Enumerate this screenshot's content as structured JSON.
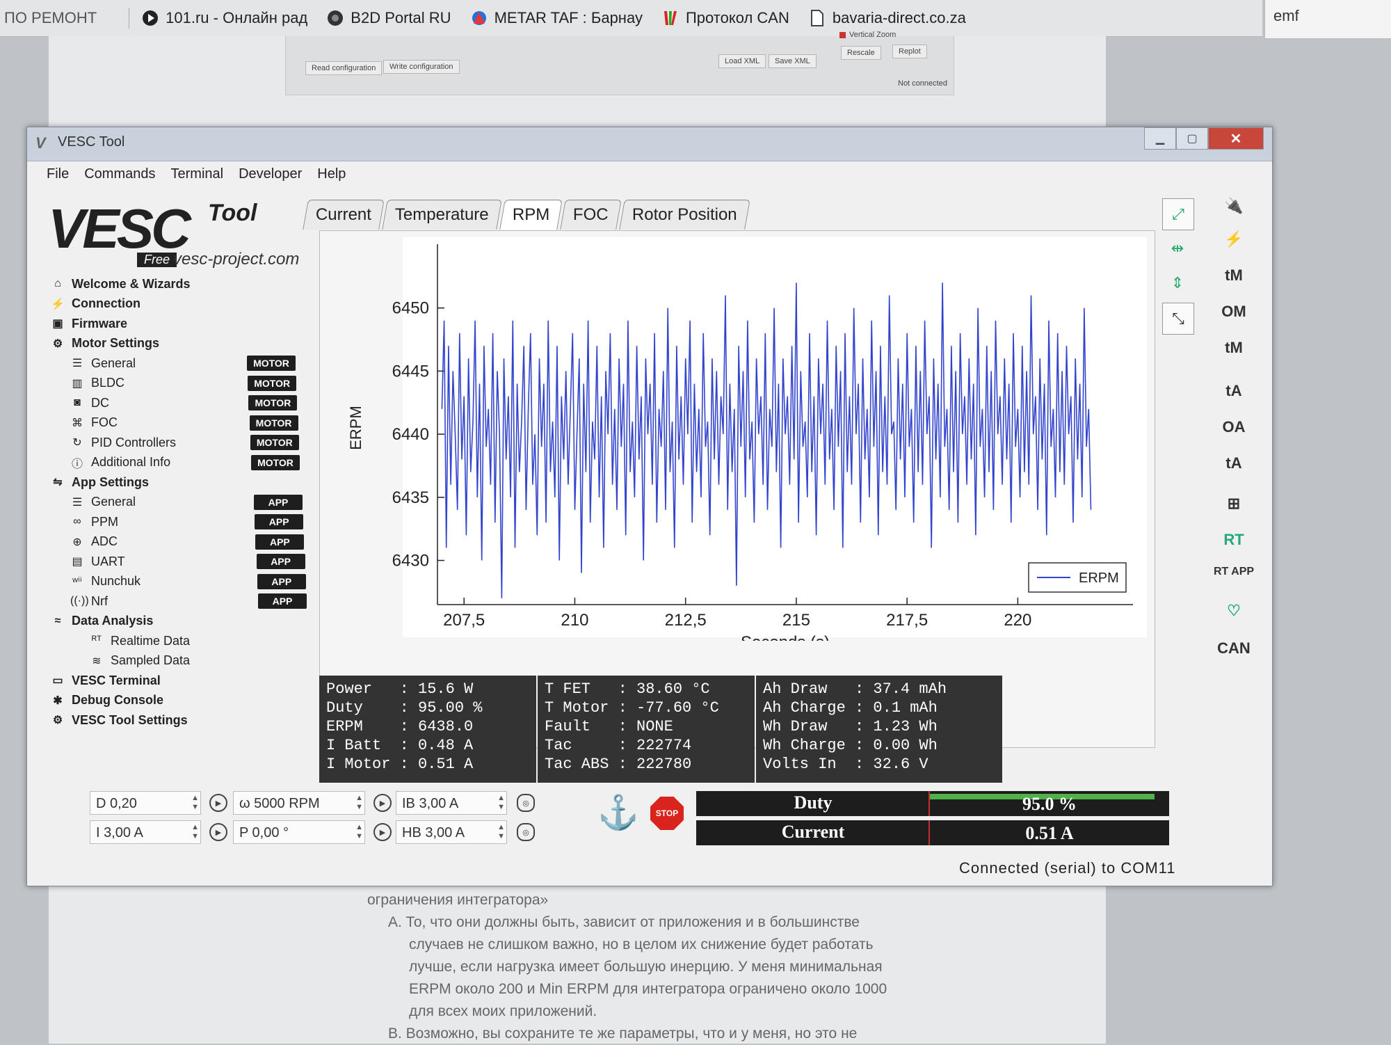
{
  "bookmarks": [
    {
      "label": "ПО РЕМОНТ"
    },
    {
      "label": "101.ru - Онлайн рад"
    },
    {
      "label": "B2D Portal RU"
    },
    {
      "label": "METAR TAF : Барнау"
    },
    {
      "label": "Протокол CAN"
    },
    {
      "label": "bavaria-direct.co.za"
    }
  ],
  "tab_emf": "emf",
  "ghost": {
    "read": "Read configuration",
    "write": "Write configuration",
    "load": "Load XML",
    "save": "Save XML",
    "vzoom": "Vertical Zoom",
    "rescale": "Rescale",
    "replot": "Replot",
    "status": "Not connected"
  },
  "window": {
    "title": "VESC Tool"
  },
  "menu": [
    "File",
    "Commands",
    "Terminal",
    "Developer",
    "Help"
  ],
  "logo": {
    "brand": "VESC",
    "tool": "Tool",
    "edition": "Free",
    "url": "vesc-project.com"
  },
  "sidebar": [
    {
      "label": "Welcome & Wizards",
      "icon": "home-icon",
      "level": 0
    },
    {
      "label": "Connection",
      "icon": "plug-icon",
      "level": 0
    },
    {
      "label": "Firmware",
      "icon": "chip-icon",
      "level": 0
    },
    {
      "label": "Motor Settings",
      "icon": "motor-icon",
      "level": 0
    },
    {
      "label": "General",
      "icon": "sliders-icon",
      "level": 1,
      "badge": "MOTOR"
    },
    {
      "label": "BLDC",
      "icon": "bldc-icon",
      "level": 1,
      "badge": "MOTOR"
    },
    {
      "label": "DC",
      "icon": "dc-icon",
      "level": 1,
      "badge": "MOTOR"
    },
    {
      "label": "FOC",
      "icon": "foc-icon",
      "level": 1,
      "badge": "MOTOR"
    },
    {
      "label": "PID Controllers",
      "icon": "pid-icon",
      "level": 1,
      "badge": "MOTOR"
    },
    {
      "label": "Additional Info",
      "icon": "info-icon",
      "level": 1,
      "badge": "MOTOR"
    },
    {
      "label": "App Settings",
      "icon": "app-icon",
      "level": 0
    },
    {
      "label": "General",
      "icon": "sliders-icon",
      "level": 1,
      "badge": "APP"
    },
    {
      "label": "PPM",
      "icon": "ppm-icon",
      "level": 1,
      "badge": "APP"
    },
    {
      "label": "ADC",
      "icon": "adc-icon",
      "level": 1,
      "badge": "APP"
    },
    {
      "label": "UART",
      "icon": "uart-icon",
      "level": 1,
      "badge": "APP"
    },
    {
      "label": "Nunchuk",
      "icon": "wii-icon",
      "level": 1,
      "badge": "APP"
    },
    {
      "label": "Nrf",
      "icon": "wireless-icon",
      "level": 1,
      "badge": "APP"
    },
    {
      "label": "Data Analysis",
      "icon": "analysis-icon",
      "level": 0
    },
    {
      "label": "Realtime Data",
      "icon": "rt-icon",
      "level": 2
    },
    {
      "label": "Sampled Data",
      "icon": "sampled-icon",
      "level": 2
    },
    {
      "label": "VESC Terminal",
      "icon": "terminal-icon",
      "level": 0
    },
    {
      "label": "Debug Console",
      "icon": "bug-icon",
      "level": 0
    },
    {
      "label": "VESC Tool Settings",
      "icon": "gear-icon",
      "level": 0
    }
  ],
  "tabs": [
    {
      "label": "Current"
    },
    {
      "label": "Temperature"
    },
    {
      "label": "RPM",
      "active": true
    },
    {
      "label": "FOC"
    },
    {
      "label": "Rotor Position"
    }
  ],
  "chart_data": {
    "type": "line",
    "xlabel": "Seconds (s)",
    "ylabel": "ERPM",
    "xlim": [
      206.9,
      222.6
    ],
    "ylim": [
      6426.5,
      6454.5
    ],
    "xticks": [
      207.5,
      210,
      212.5,
      215,
      217.5,
      220
    ],
    "xtick_labels": [
      "207,5",
      "210",
      "212,5",
      "215",
      "217,5",
      "220"
    ],
    "yticks": [
      6430,
      6435,
      6440,
      6445,
      6450
    ],
    "legend": "bottom-right",
    "series": [
      {
        "name": "ERPM",
        "color": "#3344cc",
        "x_start": 207.0,
        "x_step": 0.05,
        "values": [
          6442,
          6449,
          6431,
          6447,
          6436,
          6445,
          6440,
          6434,
          6448,
          6438,
          6443,
          6432,
          6446,
          6437,
          6441,
          6449,
          6435,
          6444,
          6430,
          6447,
          6439,
          6442,
          6436,
          6448,
          6433,
          6445,
          6440,
          6427,
          6446,
          6438,
          6443,
          6435,
          6449,
          6431,
          6444,
          6437,
          6441,
          6447,
          6434,
          6442,
          6448,
          6436,
          6440,
          6432,
          6446,
          6439,
          6444,
          6433,
          6449,
          6437,
          6441,
          6435,
          6447,
          6430,
          6443,
          6438,
          6445,
          6436,
          6442,
          6448,
          6434,
          6440,
          6446,
          6429,
          6444,
          6437,
          6449,
          6433,
          6441,
          6438,
          6447,
          6435,
          6443,
          6431,
          6445,
          6440,
          6448,
          6436,
          6442,
          6434,
          6446,
          6439,
          6444,
          6432,
          6449,
          6437,
          6441,
          6435,
          6447,
          6438,
          6443,
          6430,
          6446,
          6440,
          6444,
          6436,
          6448,
          6433,
          6442,
          6439,
          6445,
          6434,
          6450,
          6437,
          6441,
          6431,
          6447,
          6438,
          6443,
          6436,
          6446,
          6440,
          6449,
          6433,
          6444,
          6437,
          6442,
          6435,
          6448,
          6439,
          6441,
          6432,
          6446,
          6438,
          6445,
          6436,
          6443,
          6440,
          6451,
          6434,
          6444,
          6437,
          6442,
          6428,
          6447,
          6439,
          6445,
          6435,
          6449,
          6438,
          6441,
          6433,
          6446,
          6440,
          6443,
          6436,
          6448,
          6434,
          6442,
          6439,
          6450,
          6437,
          6444,
          6431,
          6446,
          6440,
          6443,
          6436,
          6447,
          6438,
          6452,
          6433,
          6445,
          6439,
          6441,
          6435,
          6448,
          6437,
          6443,
          6432,
          6446,
          6440,
          6444,
          6436,
          6449,
          6438,
          6442,
          6434,
          6447,
          6439,
          6445,
          6431,
          6448,
          6437,
          6443,
          6436,
          6450,
          6440,
          6444,
          6433,
          6446,
          6438,
          6442,
          6435,
          6449,
          6439,
          6445,
          6432,
          6447,
          6437,
          6443,
          6436,
          6451,
          6440,
          6441,
          6434,
          6446,
          6438,
          6444,
          6435,
          6448,
          6439,
          6442,
          6433,
          6447,
          6437,
          6445,
          6436,
          6449,
          6440,
          6443,
          6431,
          6446,
          6438,
          6444,
          6435,
          6452,
          6439,
          6442,
          6434,
          6447,
          6437,
          6445,
          6433,
          6448,
          6440,
          6443,
          6436,
          6446,
          6438,
          6444,
          6432,
          6450,
          6439,
          6442,
          6435,
          6447,
          6437,
          6445,
          6434,
          6449,
          6440,
          6443,
          6436,
          6446,
          6438,
          6444,
          6433,
          6448,
          6439,
          6442,
          6435,
          6447,
          6437,
          6445,
          6436,
          6451,
          6440,
          6443,
          6434,
          6446,
          6438,
          6444,
          6432,
          6449,
          6439,
          6442,
          6435,
          6448,
          6437,
          6445,
          6436,
          6447,
          6440,
          6443,
          6433,
          6446,
          6438,
          6444,
          6435,
          6450,
          6439,
          6442,
          6434
        ]
      }
    ]
  },
  "stats": {
    "col1": "Power   : 15.6 W\nDuty    : 95.00 %\nERPM    : 6438.0\nI Batt  : 0.48 A\nI Motor : 0.51 A",
    "col2": "T FET   : 38.60 °C\nT Motor : -77.60 °C\nFault   : NONE\nTac     : 222774\nTac ABS : 222780",
    "col3": "Ah Draw   : 37.4 mAh\nAh Charge : 0.1 mAh\nWh Draw   : 1.23 Wh\nWh Charge : 0.00 Wh\nVolts In  : 32.6 V"
  },
  "controls": {
    "duty": "D 0,20",
    "rpm": "ω 5000 RPM",
    "brake_current": "IB 3,00 A",
    "current": "I 3,00 A",
    "position": "P 0,00 °",
    "handbrake": "HB 3,00 A",
    "stop_label": "STOP"
  },
  "gauges": {
    "duty_label": "Duty",
    "duty_value": "95.0 %",
    "duty_fraction": 0.95,
    "current_label": "Current",
    "current_value": "0.51 A",
    "current_fraction": 0.0
  },
  "right_side": [
    "tM",
    "OM",
    "tM",
    "tA",
    "OA",
    "tA",
    "CAN"
  ],
  "status": "Connected (serial) to COM11",
  "doc_text": [
    "ограничения интегратора»",
    "А. То, что они должны быть, зависит от приложения и в большинстве",
    "случаев не слишком важно, но в целом их снижение будет работать",
    "лучше, если нагрузка имеет большую инерцию. У меня минимальная",
    "ERPM около 200 и Min ERPM для интегратора ограничено около 1000",
    "для всех моих приложений.",
    "B. Возможно, вы сохраните те же параметры, что и у меня, но это не"
  ]
}
